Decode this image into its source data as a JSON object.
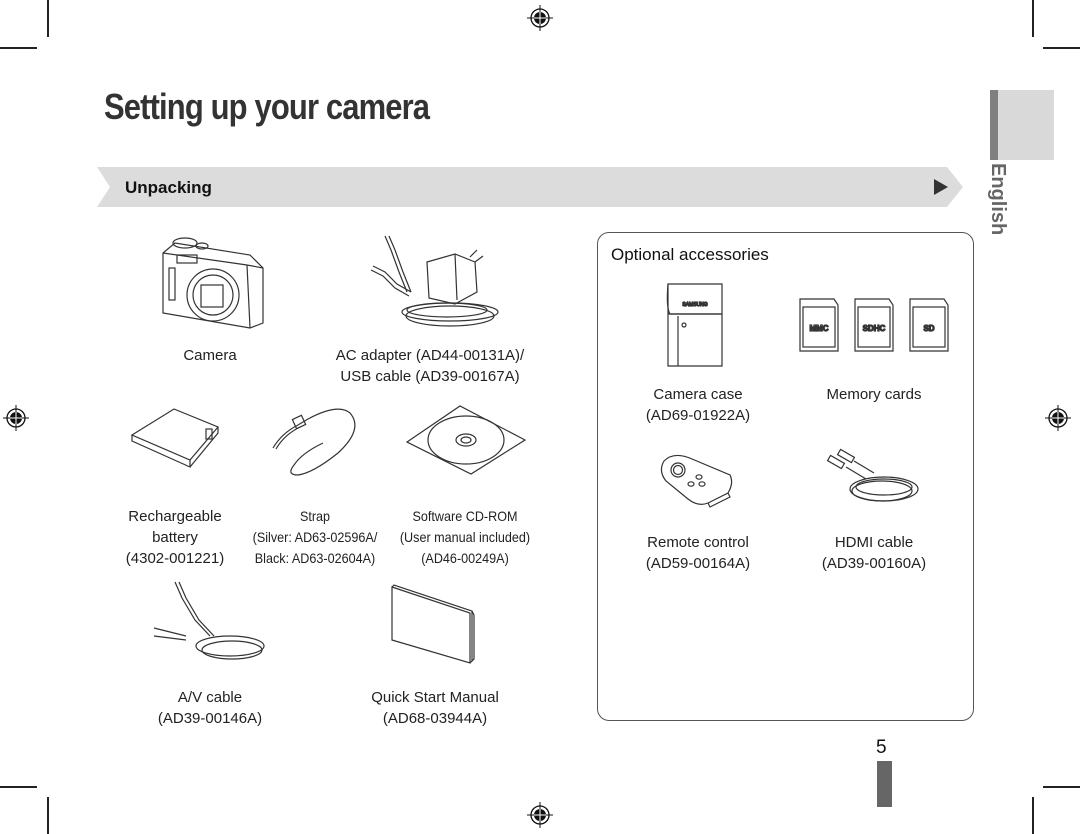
{
  "page": {
    "title": "Setting up your camera",
    "section": "Unpacking",
    "language_tab": "English",
    "page_number": "5"
  },
  "included_items": [
    {
      "name": "Camera",
      "lines": [
        "Camera"
      ],
      "icon": "camera-icon"
    },
    {
      "name": "AC adapter / USB cable",
      "lines": [
        "AC adapter (AD44-00131A)/",
        "USB cable (AD39-00167A)"
      ],
      "icon": "ac-adapter-icon"
    },
    {
      "name": "Rechargeable battery",
      "lines": [
        "Rechargeable",
        "battery",
        "(4302-001221)"
      ],
      "icon": "battery-icon"
    },
    {
      "name": "Strap",
      "lines": [
        "Strap",
        "(Silver: AD63-02596A/",
        "Black: AD63-02604A)"
      ],
      "icon": "strap-icon"
    },
    {
      "name": "Software CD-ROM",
      "lines": [
        "Software CD-ROM",
        "(User manual included)",
        "(AD46-00249A)"
      ],
      "icon": "cd-rom-icon"
    },
    {
      "name": "A/V cable",
      "lines": [
        "A/V cable",
        "(AD39-00146A)"
      ],
      "icon": "av-cable-icon"
    },
    {
      "name": "Quick Start Manual",
      "lines": [
        "Quick Start Manual",
        "(AD68-03944A)"
      ],
      "icon": "manual-icon"
    }
  ],
  "optional": {
    "title": "Optional accessories",
    "items": [
      {
        "name": "Camera case",
        "lines": [
          "Camera case",
          "(AD69-01922A)"
        ],
        "icon": "camera-case-icon",
        "brand": "SAMSUNG"
      },
      {
        "name": "Memory cards",
        "lines": [
          "Memory cards"
        ],
        "icon": "memory-card-icon",
        "cards": [
          "MMC",
          "SDHC",
          "SD"
        ]
      },
      {
        "name": "Remote control",
        "lines": [
          "Remote control",
          "(AD59-00164A)"
        ],
        "icon": "remote-control-icon"
      },
      {
        "name": "HDMI cable",
        "lines": [
          "HDMI cable",
          "(AD39-00160A)"
        ],
        "icon": "hdmi-cable-icon"
      }
    ]
  },
  "colors": {
    "section_bar": "#dcdcdc",
    "tab_gray": "#d9d9d9",
    "tab_accent": "#808080",
    "page_bar": "#666666"
  }
}
